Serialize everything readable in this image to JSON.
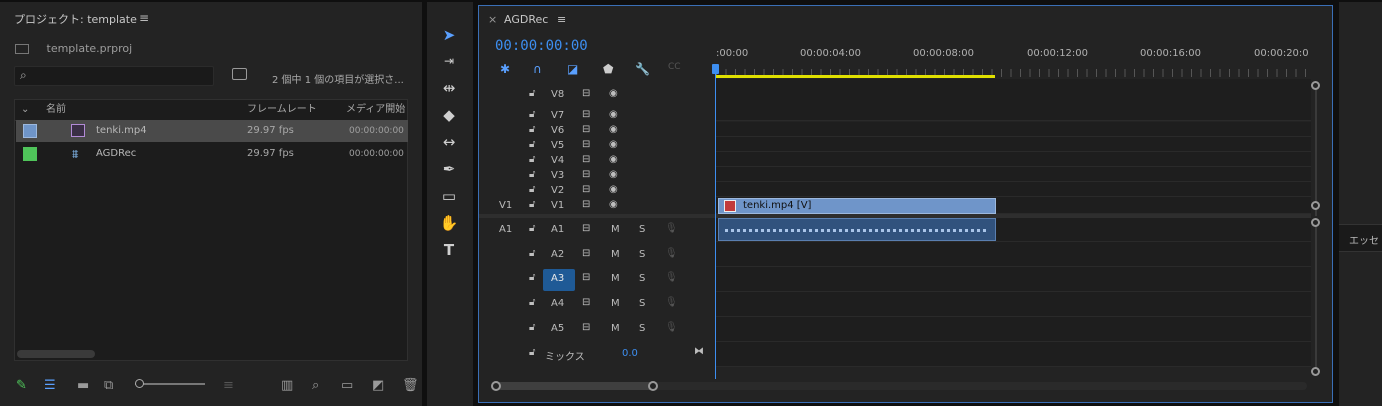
{
  "project": {
    "title": "プロジェクト: template",
    "file_name": "template.prproj",
    "selection_status": "2 個中 1 個の項目が選択さ...",
    "columns": [
      "名前",
      "フレームレート",
      "メディア開始"
    ],
    "items": [
      {
        "name": "tenki.mp4",
        "fps": "29.97 fps",
        "start": "00:00:00:00",
        "color": "#6f95c9",
        "selected": true
      },
      {
        "name": "AGDRec",
        "fps": "29.97 fps",
        "start": "00:00:00:00",
        "color": "#4fc45a",
        "selected": false
      }
    ]
  },
  "timeline": {
    "sequence_name": "AGDRec",
    "timecode": "00:00:00:00",
    "ruler_labels": [
      ":00:00",
      "00:00:04:00",
      "00:00:08:00",
      "00:00:12:00",
      "00:00:16:00",
      "00:00:20:0"
    ],
    "video_tracks": [
      "V8",
      "V7",
      "V6",
      "V5",
      "V4",
      "V3",
      "V2",
      "V1"
    ],
    "audio_tracks": [
      "A1",
      "A2",
      "A3",
      "A4",
      "A5"
    ],
    "source_video": "V1",
    "source_audio": "A1",
    "mute_label": "M",
    "solo_label": "S",
    "mix_label": "ミックス",
    "mix_value": "0.0",
    "clip_label": "tenki.mp4 [V]",
    "accent_color": "#3d8ef0",
    "clip_color": "#6f95c9"
  },
  "right_panel": {
    "tab_label": "エッセ"
  }
}
